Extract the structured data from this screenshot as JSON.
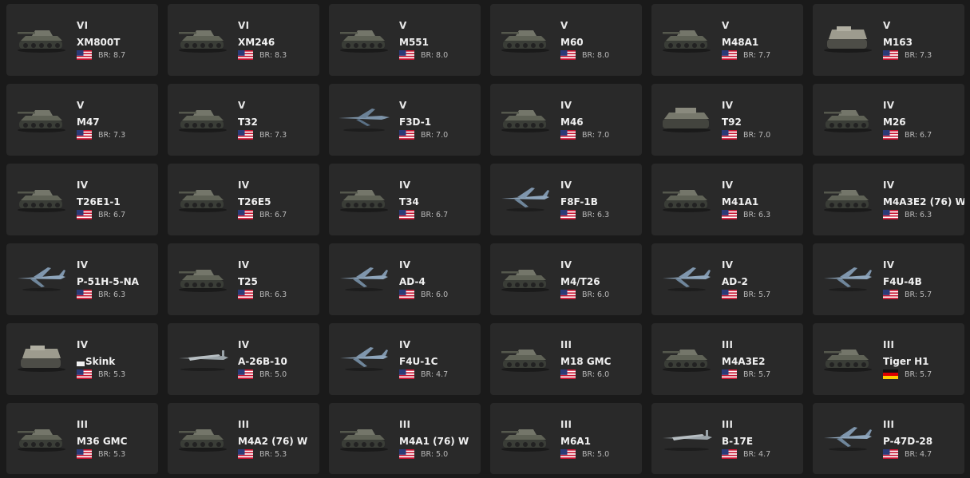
{
  "vehicles": [
    {
      "tier": "VI",
      "name": "XM800T",
      "country": "usa",
      "br": "BR: 8.7",
      "icon": "tank-icon"
    },
    {
      "tier": "VI",
      "name": "XM246",
      "country": "usa",
      "br": "BR: 8.3",
      "icon": "tank-icon"
    },
    {
      "tier": "V",
      "name": "M551",
      "country": "usa",
      "br": "BR: 8.0",
      "icon": "tank-icon"
    },
    {
      "tier": "V",
      "name": "M60",
      "country": "usa",
      "br": "BR: 8.0",
      "icon": "tank-icon"
    },
    {
      "tier": "V",
      "name": "M48A1",
      "country": "usa",
      "br": "BR: 7.7",
      "icon": "tank-icon"
    },
    {
      "tier": "V",
      "name": "M163",
      "country": "usa",
      "br": "BR: 7.3",
      "icon": "spaa-icon"
    },
    {
      "tier": "V",
      "name": "M47",
      "country": "usa",
      "br": "BR: 7.3",
      "icon": "tank-icon"
    },
    {
      "tier": "V",
      "name": "T32",
      "country": "usa",
      "br": "BR: 7.3",
      "icon": "tank-icon"
    },
    {
      "tier": "V",
      "name": "F3D-1",
      "country": "usa",
      "br": "BR: 7.0",
      "icon": "jet-icon"
    },
    {
      "tier": "IV",
      "name": "M46",
      "country": "usa",
      "br": "BR: 7.0",
      "icon": "tank-icon"
    },
    {
      "tier": "IV",
      "name": "T92",
      "country": "usa",
      "br": "BR: 7.0",
      "icon": "spg-icon"
    },
    {
      "tier": "IV",
      "name": "M26",
      "country": "usa",
      "br": "BR: 6.7",
      "icon": "tank-icon"
    },
    {
      "tier": "IV",
      "name": "T26E1-1",
      "country": "usa",
      "br": "BR: 6.7",
      "icon": "tank-icon"
    },
    {
      "tier": "IV",
      "name": "T26E5",
      "country": "usa",
      "br": "BR: 6.7",
      "icon": "tank-icon"
    },
    {
      "tier": "IV",
      "name": "T34",
      "country": "usa",
      "br": "BR: 6.7",
      "icon": "tank-icon"
    },
    {
      "tier": "IV",
      "name": "F8F-1B",
      "country": "usa",
      "br": "BR: 6.3",
      "icon": "plane-icon"
    },
    {
      "tier": "IV",
      "name": "M41A1",
      "country": "usa",
      "br": "BR: 6.3",
      "icon": "tank-icon"
    },
    {
      "tier": "IV",
      "name": "M4A3E2 (76) W",
      "country": "usa",
      "br": "BR: 6.3",
      "icon": "tank-icon"
    },
    {
      "tier": "IV",
      "name": "P-51H-5-NA",
      "country": "usa",
      "br": "BR: 6.3",
      "icon": "plane-icon"
    },
    {
      "tier": "IV",
      "name": "T25",
      "country": "usa",
      "br": "BR: 6.3",
      "icon": "tank-icon"
    },
    {
      "tier": "IV",
      "name": "AD-4",
      "country": "usa",
      "br": "BR: 6.0",
      "icon": "plane-icon"
    },
    {
      "tier": "IV",
      "name": "M4/T26",
      "country": "usa",
      "br": "BR: 6.0",
      "icon": "tank-icon"
    },
    {
      "tier": "IV",
      "name": "AD-2",
      "country": "usa",
      "br": "BR: 5.7",
      "icon": "plane-icon"
    },
    {
      "tier": "IV",
      "name": "F4U-4B",
      "country": "usa",
      "br": "BR: 5.7",
      "icon": "plane-icon"
    },
    {
      "tier": "IV",
      "name": "Skink",
      "country": "usa",
      "br": "BR: 5.3",
      "icon": "spaa-icon",
      "badge": true
    },
    {
      "tier": "IV",
      "name": "A-26B-10",
      "country": "usa",
      "br": "BR: 5.0",
      "icon": "bomber-icon"
    },
    {
      "tier": "IV",
      "name": "F4U-1C",
      "country": "usa",
      "br": "BR: 4.7",
      "icon": "plane-icon"
    },
    {
      "tier": "III",
      "name": "M18 GMC",
      "country": "usa",
      "br": "BR: 6.0",
      "icon": "tank-icon"
    },
    {
      "tier": "III",
      "name": "M4A3E2",
      "country": "usa",
      "br": "BR: 5.7",
      "icon": "tank-icon"
    },
    {
      "tier": "III",
      "name": "Tiger H1",
      "country": "germany",
      "br": "BR: 5.7",
      "icon": "tank-icon"
    },
    {
      "tier": "III",
      "name": "M36 GMC",
      "country": "usa",
      "br": "BR: 5.3",
      "icon": "tank-icon"
    },
    {
      "tier": "III",
      "name": "M4A2 (76) W",
      "country": "usa",
      "br": "BR: 5.3",
      "icon": "tank-icon"
    },
    {
      "tier": "III",
      "name": "M4A1 (76) W",
      "country": "usa",
      "br": "BR: 5.0",
      "icon": "tank-icon"
    },
    {
      "tier": "III",
      "name": "M6A1",
      "country": "usa",
      "br": "BR: 5.0",
      "icon": "tank-icon"
    },
    {
      "tier": "III",
      "name": "B-17E",
      "country": "usa",
      "br": "BR: 4.7",
      "icon": "bomber-icon"
    },
    {
      "tier": "III",
      "name": "P-47D-28",
      "country": "usa",
      "br": "BR: 4.7",
      "icon": "plane-icon"
    }
  ],
  "colors": {
    "background": "#1a1a1a",
    "card": "#292929",
    "text": "#f0f0f0",
    "br_text": "#b9b9b9"
  }
}
